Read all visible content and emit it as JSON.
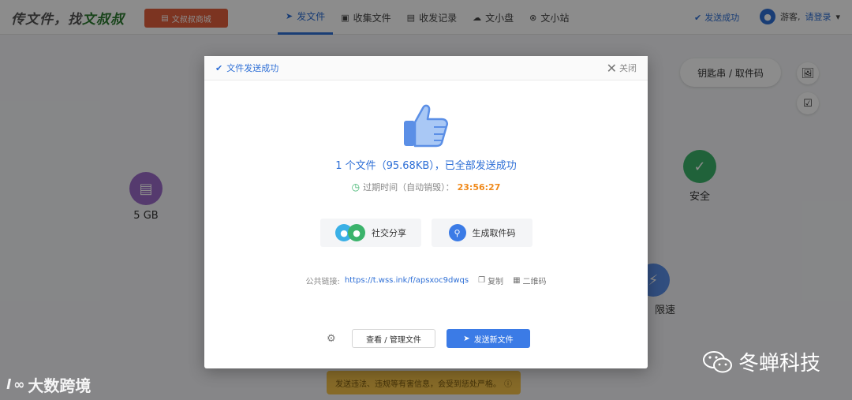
{
  "header": {
    "logo_prefix": "传文件，找",
    "logo_brand": "文叔叔",
    "store_button": "文叔叔商城",
    "nav": [
      {
        "label": "发文件",
        "icon": "send-icon",
        "active": true
      },
      {
        "label": "收集文件",
        "icon": "collect-icon",
        "active": false
      },
      {
        "label": "收发记录",
        "icon": "records-icon",
        "active": false
      },
      {
        "label": "文小盘",
        "icon": "cloud-icon",
        "active": false
      },
      {
        "label": "文小站",
        "icon": "compass-icon",
        "active": false
      }
    ],
    "status": "发送成功",
    "user_guest": "游客,",
    "user_login": "请登录"
  },
  "background": {
    "storage_label": "5 GB",
    "security_label": "安全",
    "speed_label": "限速",
    "key_button": "钥匙串 / 取件码",
    "warning": "发送违法、违规等有害信息，会受到惩处严格。"
  },
  "modal": {
    "title": "文件发送成功",
    "close_label": "关闭",
    "success_message": "1 个文件（95.68KB），已全部发送成功",
    "expire_label": "过期时间（自动销毁）：",
    "expire_time": "23:56:27",
    "share_button": "社交分享",
    "code_button": "生成取件码",
    "link_label": "公共链接:",
    "link_url": "https://t.wss.ink/f/apsxoc9dwqs",
    "copy_label": "复制",
    "qr_label": "二维码",
    "view_button": "查看 / 管理文件",
    "send_new_button": "发送新文件"
  },
  "watermarks": {
    "left_mark": "l ∞",
    "left_text": "大数跨境",
    "right_text": "冬蝉科技"
  },
  "colors": {
    "accent": "#2e6fd6",
    "primary_button": "#3b7be6",
    "store_button": "#e2603d",
    "timer": "#f08a1c",
    "security_green": "#3bb36b"
  }
}
